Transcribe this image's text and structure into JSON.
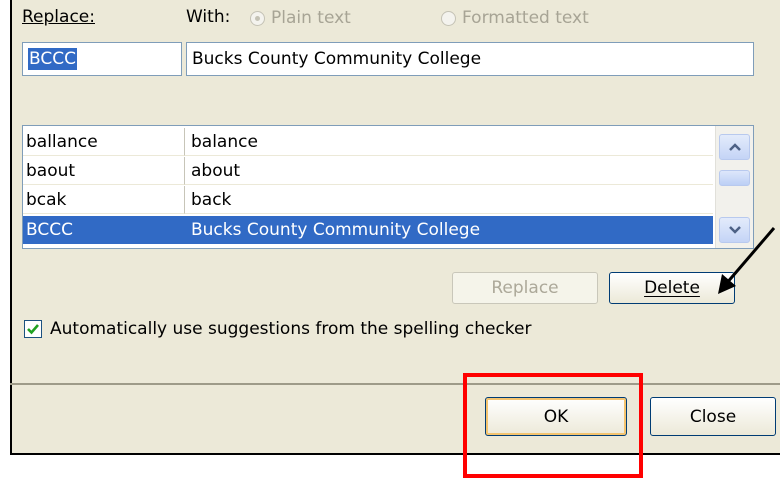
{
  "labels": {
    "replace": "Replace:",
    "with": "With:",
    "plain_text": "Plain text",
    "formatted_text": "Formatted text"
  },
  "inputs": {
    "replace_value": "BCCC",
    "with_value": "Bucks County Community College"
  },
  "entries": [
    {
      "replace": "ballance",
      "with": "balance"
    },
    {
      "replace": "baout",
      "with": "about"
    },
    {
      "replace": "bcak",
      "with": "back"
    },
    {
      "replace": "BCCC",
      "with": "Bucks County Community College"
    }
  ],
  "selected_entry": "BCCC",
  "buttons": {
    "replace": "Replace",
    "delete": "Delete",
    "ok": "OK",
    "close": "Close"
  },
  "checkbox": {
    "label": "Automatically use suggestions from the spelling checker",
    "checked": true
  },
  "colors": {
    "selection": "#316ac5",
    "dialog_bg": "#ece9d8",
    "highlight_box": "#ff0000"
  },
  "icons": {
    "scroll_up": "chevron-up-icon",
    "scroll_down": "chevron-down-icon",
    "checkmark": "check-icon",
    "annotation_arrow": "arrow-icon"
  }
}
